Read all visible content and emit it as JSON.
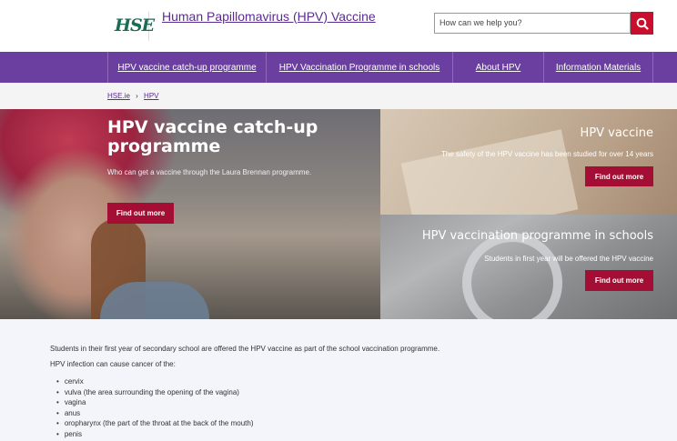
{
  "header": {
    "logo_text": "HSE",
    "title": "Human Papillomavirus (HPV) Vaccine",
    "search_placeholder": "How can we help you?"
  },
  "nav": {
    "items": [
      {
        "label": "HPV vaccine catch-up programme"
      },
      {
        "label": "HPV Vaccination Programme in schools"
      },
      {
        "label": "About HPV"
      },
      {
        "label": "Information Materials"
      }
    ]
  },
  "breadcrumb": {
    "items": [
      "HSE.ie",
      "HPV"
    ],
    "separator": "›"
  },
  "hero": {
    "main": {
      "title": "HPV vaccine catch-up programme",
      "subtitle": "Who can get a vaccine through the Laura Brennan programme.",
      "button": "Find out more"
    },
    "top": {
      "title": "HPV vaccine",
      "subtitle": "The safety of the HPV vaccine has been studied for over 14 years",
      "button": "Find out more"
    },
    "bottom": {
      "title": "HPV vaccination programme in schools",
      "subtitle": "Students in first year will be offered the HPV vaccine",
      "button": "Find out more"
    }
  },
  "content": {
    "intro": "Students in their first year of secondary school are offered the HPV vaccine as part of the school vaccination programme.",
    "lead": "HPV infection can cause cancer of the:",
    "list": [
      "cervix",
      "vulva (the area surrounding the opening of the vagina)",
      "vagina",
      "anus",
      "oropharynx (the part of the throat at the back of the mouth)",
      "penis"
    ]
  },
  "colors": {
    "brand_purple": "#6b3fa0",
    "accent_red": "#a50e34",
    "search_red": "#c8102e",
    "logo_green": "#1c6b55"
  },
  "icons": {
    "search": "search-icon"
  }
}
